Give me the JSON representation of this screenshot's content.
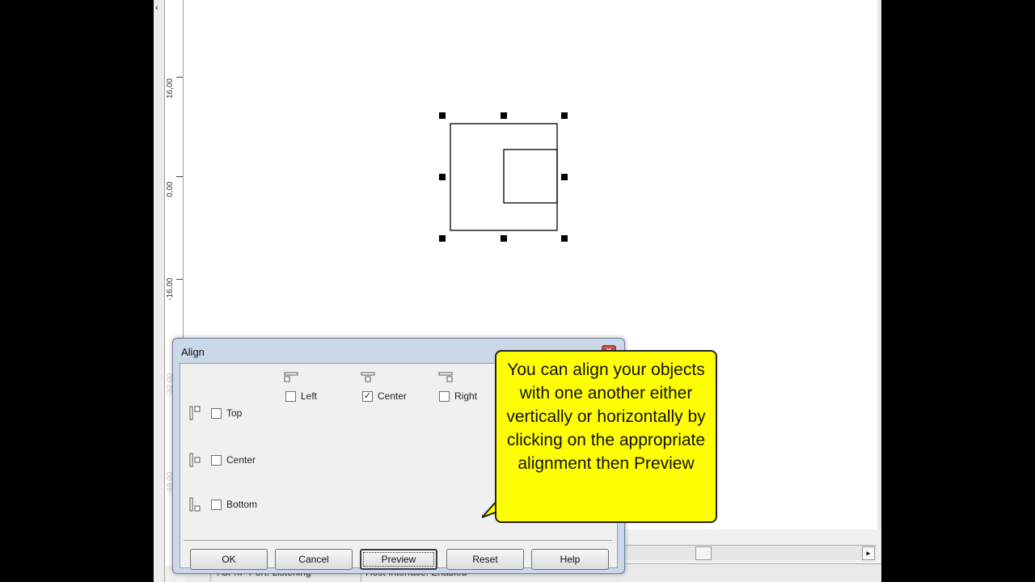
{
  "ruler": {
    "labels": [
      "16,00",
      "0,00",
      "-16,00",
      "-32,00",
      "-48,00"
    ]
  },
  "statusbar": {
    "tcp": "TCP/IP Port: Listening",
    "host": "Host Interface: Enabled"
  },
  "dialog": {
    "title": "Align",
    "close_icon": "close-icon",
    "horizontal": [
      {
        "label": "Left",
        "checked": false
      },
      {
        "label": "Center",
        "checked": true
      },
      {
        "label": "Right",
        "checked": false
      }
    ],
    "vertical": [
      {
        "label": "Top",
        "checked": false
      },
      {
        "label": "Center",
        "checked": false
      },
      {
        "label": "Bottom",
        "checked": false
      }
    ],
    "buttons": {
      "ok": "OK",
      "cancel": "Cancel",
      "preview": "Preview",
      "reset": "Reset",
      "help": "Help"
    },
    "check_mark": "✓"
  },
  "callout": {
    "text": "You can align your objects with one another either vertically or horizontally by clicking on the appropriate alignment then Preview"
  },
  "icons": {
    "collapse": "‹",
    "scroll_right": "►"
  },
  "colors": {
    "callout_bg": "#ffff00",
    "dialog_frame": "#cbd8e8",
    "close_button": "#c9504a"
  }
}
